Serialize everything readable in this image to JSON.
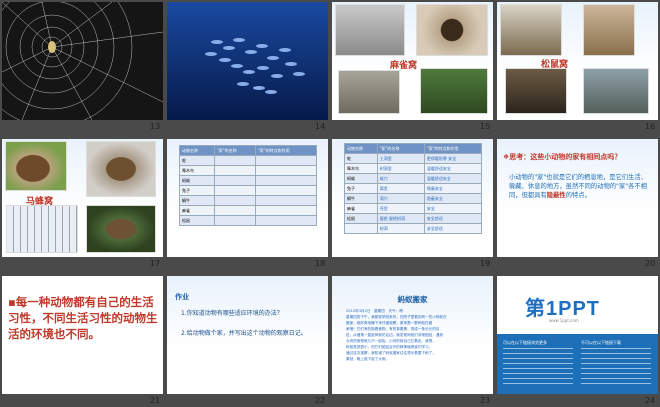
{
  "slides": [
    {
      "num": "13"
    },
    {
      "num": "14"
    },
    {
      "num": "15",
      "caption": "麻雀窝"
    },
    {
      "num": "16",
      "caption": "松鼠窝"
    },
    {
      "num": "17",
      "caption": "马蜂窝"
    },
    {
      "num": "18",
      "headers": [
        "动物名称",
        "\"家\"的名称",
        "\"家\"的特点和作用"
      ],
      "rows": [
        "蛇",
        "啄木鸟",
        "蚂蚁",
        "兔子",
        "蜗牛",
        "麻雀",
        "松鼠"
      ]
    },
    {
      "num": "19",
      "headers": [
        "动物名称",
        "\"家\"的名称",
        "\"家\"的特点和作用"
      ],
      "rows": [
        [
          "蛇",
          "土洞里",
          "更保暖防寒 安全"
        ],
        [
          "啄木鸟",
          "树洞里",
          "温暖舒适安全"
        ],
        [
          "蚂蚁",
          "蚁穴",
          "温暖舒适安全"
        ],
        [
          "兔子",
          "窝里",
          "隐蔽安全"
        ],
        [
          "蜗牛",
          "洞穴",
          "隐蔽安全"
        ],
        [
          "麻雀",
          "壳里",
          "安全"
        ],
        [
          "松鼠",
          "屋檐 屋檐树洞",
          "安全舒适"
        ],
        [
          "",
          "树洞",
          "安全舒适"
        ]
      ]
    },
    {
      "num": "20",
      "question": "思考：这些小动物的家有相同点吗？",
      "body_pre": "小动物的\"家\"也就是它们的栖息地，是它们生活、躲藏、休息的地方，虽然不同的动物的\"家\"各不相同，但都具有",
      "body_em": "隐蔽性",
      "body_post": "的特点。"
    },
    {
      "num": "21",
      "text": "每一种动物都有自己的生活习性，不同生活习性的动物生活的环境也不同。"
    },
    {
      "num": "22",
      "title": "作业",
      "q1": "1.你知道动物有哪些适应环境的办法？",
      "q2": "2.给动物做个家，并写出这个动物的观察日记。"
    },
    {
      "num": "23",
      "title": "蚂蚁搬家",
      "lines": [
        "2010年3月2日　星期四　天气：晴",
        "星期四的下午，我刚放学回来时，在院子里看到有一些小蚂蚁在",
        "搬家，我好奇地蹲下来仔细观察，原来是一群蚂蚁在搬",
        "家哩！它们有的拖着食物，有的背着蛋，排成一条长长的队",
        "伍，从墙角一直延伸到花坛边。我发现蚂蚁们非常团结，遇到",
        "大块的食物就几只一起抬，小块的就自己扛着走。我想，",
        "蚂蚁虽然很小，但它们团结合作的精神值得我们学习。",
        "通过这次观察，我知道了蚂蚁搬家往往预示着要下雨了。",
        "果然，晚上就下起了大雨。"
      ]
    },
    {
      "num": "24",
      "brand": "第1PPT",
      "sub": "www.1ppt.com",
      "links_left": "可以在以下链接浏览更多",
      "links_right": "不可以在以下链接下载"
    }
  ]
}
